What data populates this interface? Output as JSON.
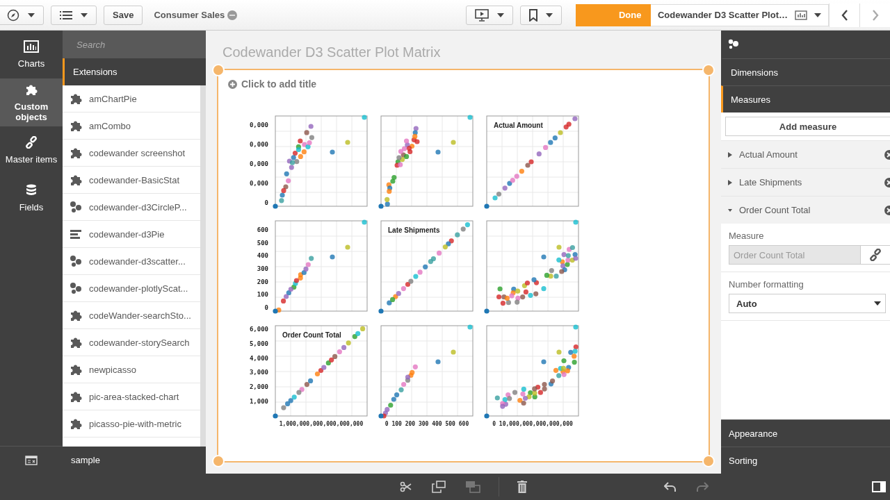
{
  "toolbar": {
    "save_label": "Save",
    "app_name": "Consumer Sales",
    "done_label": "Done",
    "sheet_title": "Codewander D3 Scatter Plot…",
    "nav": [
      {
        "kind": "prev",
        "disabled": false
      },
      {
        "kind": "next",
        "disabled": true
      }
    ]
  },
  "assets_rail": [
    {
      "label": "Charts",
      "kind": "charts",
      "selected": false
    },
    {
      "label": "Custom objects",
      "kind": "puzzle",
      "selected": true
    },
    {
      "label": "Master items",
      "kind": "link",
      "selected": false
    },
    {
      "label": "Fields",
      "kind": "database",
      "selected": false
    }
  ],
  "assets_panel": {
    "search": {
      "placeholder": "Search"
    },
    "section": "Extensions",
    "items": [
      {
        "label": "amChartPie",
        "kind": "puzzle"
      },
      {
        "label": "amCombo",
        "kind": "puzzle"
      },
      {
        "label": "codewander screenshot",
        "kind": "puzzle"
      },
      {
        "label": "codewander-BasicStat",
        "kind": "puzzle"
      },
      {
        "label": "codewander-d3CircleP...",
        "kind": "bubbles"
      },
      {
        "label": "codewander-d3Pie",
        "kind": "lines"
      },
      {
        "label": "codewander-d3scatter...",
        "kind": "bubbles"
      },
      {
        "label": "codewander-plotlyScat...",
        "kind": "bubbles"
      },
      {
        "label": "codeWander-searchSto...",
        "kind": "puzzle"
      },
      {
        "label": "codewander-storySearch",
        "kind": "puzzle"
      },
      {
        "label": "newpicasso",
        "kind": "puzzle"
      },
      {
        "label": "pic-area-stacked-chart",
        "kind": "puzzle"
      },
      {
        "label": "picasso-pie-with-metric",
        "kind": "puzzle"
      }
    ],
    "footer": "sample"
  },
  "sheet": {
    "title": "Codewander D3 Scatter Plot Matrix",
    "object_title_placeholder": "Click to add title",
    "matrix": {
      "rows": [
        {
          "y_ticks": [
            "0,000",
            "0,000",
            "0,000",
            "0,000",
            "0"
          ],
          "panels": [
            {
              "kind": "curve"
            },
            {
              "kind": "curve"
            },
            {
              "kind": "diagonal",
              "title": "Actual Amount"
            }
          ]
        },
        {
          "y_ticks": [
            "600",
            "500",
            "400",
            "300",
            "200",
            "100",
            "0"
          ],
          "panels": [
            {
              "kind": "linear"
            },
            {
              "kind": "diagonal",
              "title": "Late Shipments"
            },
            {
              "kind": "spread"
            }
          ]
        },
        {
          "y_ticks": [
            "6,000",
            "5,000",
            "4,000",
            "3,000",
            "2,000",
            "1,000"
          ],
          "panels": [
            {
              "kind": "diagonal",
              "title": "Order Count Total"
            },
            {
              "kind": "linear"
            },
            {
              "kind": "spread"
            }
          ]
        }
      ],
      "x_ticks": [
        "1,000,000,000,000,000,000",
        "0 100 200 300 400 500 600",
        "0 10,000,000,000,000,000"
      ]
    }
  },
  "properties": {
    "tabs": [
      {
        "label": "Dimensions",
        "selected": false
      },
      {
        "label": "Measures",
        "selected": true
      }
    ],
    "add_button": "Add measure",
    "measures": [
      {
        "label": "Actual Amount",
        "expanded": false
      },
      {
        "label": "Late Shipments",
        "expanded": false
      },
      {
        "label": "Order Count Total",
        "expanded": true
      }
    ],
    "measure_field": {
      "label": "Measure",
      "value": "Order Count Total",
      "disabled": true
    },
    "number_formatting": {
      "label": "Number formatting",
      "value": "Auto"
    },
    "sections": [
      "Appearance",
      "Sorting"
    ]
  },
  "bottom_bar": {
    "edit_tools": [
      {
        "kind": "cut",
        "disabled": false
      },
      {
        "kind": "copy",
        "disabled": false
      },
      {
        "kind": "paste",
        "disabled": true
      },
      {
        "kind": "delete",
        "disabled": false
      }
    ],
    "history": [
      {
        "kind": "undo",
        "disabled": false
      },
      {
        "kind": "redo",
        "disabled": true
      }
    ]
  }
}
